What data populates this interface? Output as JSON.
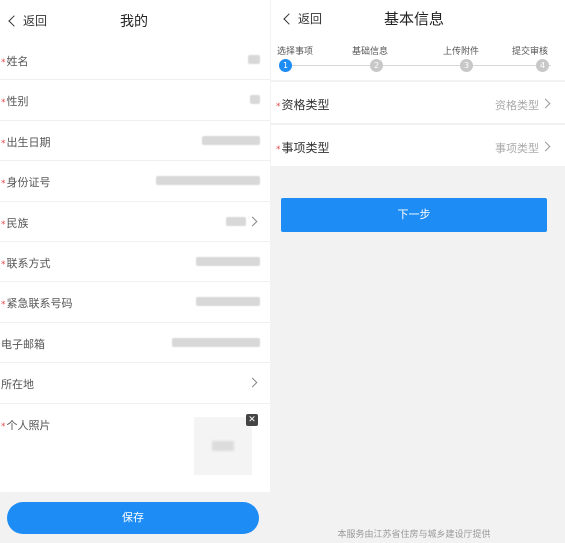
{
  "left_panel": {
    "back_label": "返回",
    "title": "我的",
    "fields": [
      {
        "label": "姓名",
        "required": true
      },
      {
        "label": "性别",
        "required": true
      },
      {
        "label": "出生日期",
        "required": true
      },
      {
        "label": "身份证号",
        "required": true
      },
      {
        "label": "民族",
        "required": true
      },
      {
        "label": "联系方式",
        "required": true
      },
      {
        "label": "紧急联系号码",
        "required": true
      },
      {
        "label": "电子邮箱",
        "required": false
      },
      {
        "label": "所在地",
        "required": false
      },
      {
        "label": "个人照片",
        "required": true
      }
    ],
    "required_mark": "*",
    "photo_close": "✕",
    "save_label": "保存"
  },
  "right_panel": {
    "back_label": "返回",
    "title": "基本信息",
    "steps": [
      {
        "label": "选择事项",
        "number": "1",
        "active": true
      },
      {
        "label": "基础信息",
        "number": "2",
        "active": false
      },
      {
        "label": "上传附件",
        "number": "3",
        "active": false
      },
      {
        "label": "提交审核",
        "number": "4",
        "active": false
      }
    ],
    "selects": [
      {
        "label": "资格类型",
        "placeholder": "资格类型"
      },
      {
        "label": "事项类型",
        "placeholder": "事项类型"
      }
    ],
    "next_label": "下一步",
    "footer": "本服务由江苏省住房与城乡建设厅提供"
  },
  "colors": {
    "accent": "#1e8cf5",
    "required": "#e84a4a",
    "background": "#f2f2f2"
  }
}
